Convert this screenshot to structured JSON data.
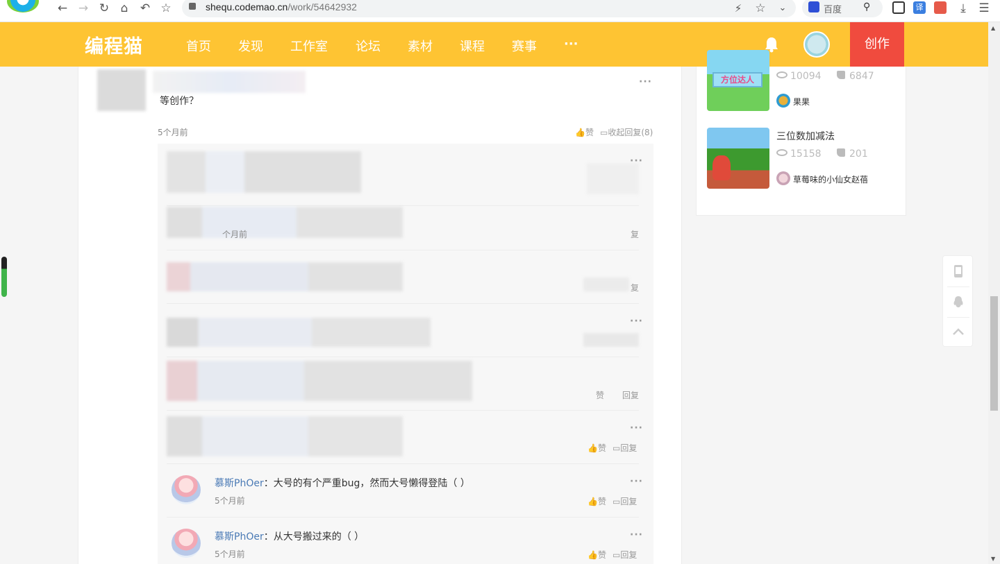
{
  "browser": {
    "url_host": "shequ.codemao.cn",
    "url_path": "/work/54642932",
    "search_engine": "百度"
  },
  "header": {
    "logo": "编程猫",
    "nav": [
      "首页",
      "发现",
      "工作室",
      "论坛",
      "素材",
      "课程",
      "赛事",
      "···"
    ],
    "create_label": "创作",
    "accent": "#fec433",
    "create_color": "#f04b3e"
  },
  "comment": {
    "text_fragment": "等创作？",
    "time": "5个月前",
    "like_label": "赞",
    "collapse_label": "收起回复(8)",
    "more": "···"
  },
  "replies": {
    "items": [
      {
        "time": "",
        "like": "",
        "reply": ""
      },
      {
        "time": "个月前",
        "like": "",
        "reply": "复"
      },
      {
        "time": "",
        "like": "",
        "reply": "复"
      },
      {
        "time": "",
        "like": "",
        "reply": ""
      },
      {
        "time": "",
        "like": "赞",
        "reply": "回复"
      },
      {
        "time": "",
        "like": "赞",
        "reply": "回复"
      },
      {
        "user": "慕斯PhOer",
        "text": "：大号的有个严重bug，然而大号懒得登陆（ ）",
        "time": "5个月前",
        "like": "赞",
        "reply": "回复"
      },
      {
        "user": "慕斯PhOer",
        "text": "：从大号搬过来的（ ）",
        "time": "5个月前",
        "like": "赞",
        "reply": "回复"
      }
    ]
  },
  "sidebar": {
    "works": [
      {
        "thumb_text": "方位达人",
        "views": "10094",
        "likes": "6847",
        "author": "果果"
      },
      {
        "title": "三位数加减法",
        "views": "15158",
        "likes": "201",
        "author": "草莓味的小仙女赵蓓"
      }
    ]
  }
}
